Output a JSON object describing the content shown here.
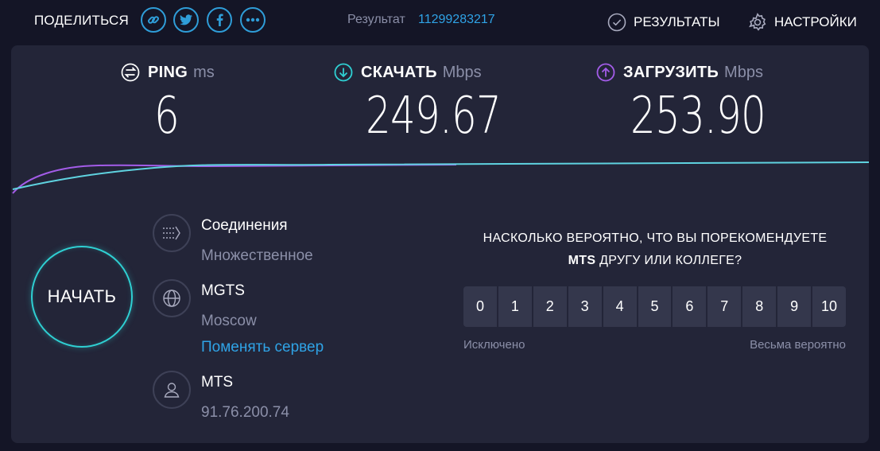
{
  "header": {
    "share_label": "ПОДЕЛИТЬСЯ",
    "share_buttons": [
      "link-icon",
      "twitter-icon",
      "facebook-icon",
      "more-icon"
    ],
    "result_label": "Результат",
    "result_id": "11299283217",
    "results_label": "РЕЗУЛЬТАТЫ",
    "settings_label": "НАСТРОЙКИ"
  },
  "metrics": {
    "ping": {
      "name": "PING",
      "unit": "ms",
      "value": "6"
    },
    "download": {
      "name": "СКАЧАТЬ",
      "unit": "Mbps",
      "value": "249.67"
    },
    "upload": {
      "name": "ЗАГРУЗИТЬ",
      "unit": "Mbps",
      "value": "253.90"
    }
  },
  "start_label": "НАЧАТЬ",
  "connection": {
    "title": "Соединения",
    "value": "Множественное"
  },
  "server": {
    "name": "MGTS",
    "location": "Moscow",
    "change_label": "Поменять сервер"
  },
  "provider": {
    "name": "MTS",
    "ip": "91.76.200.74"
  },
  "survey": {
    "question_part1": "НАСКОЛЬКО ВЕРОЯТНО, ЧТО ВЫ ПОРЕКОМЕНДУЕТЕ",
    "brand": "MTS",
    "question_part2": "ДРУГУ ИЛИ КОЛЛЕГЕ?",
    "scale": [
      "0",
      "1",
      "2",
      "3",
      "4",
      "5",
      "6",
      "7",
      "8",
      "9",
      "10"
    ],
    "low_label": "Исключено",
    "high_label": "Весьма вероятно"
  },
  "colors": {
    "accent_blue": "#2fa3e6",
    "download_cyan": "#2fd0d3",
    "upload_purple": "#a35ce8",
    "background": "#141526",
    "panel": "#232538"
  }
}
